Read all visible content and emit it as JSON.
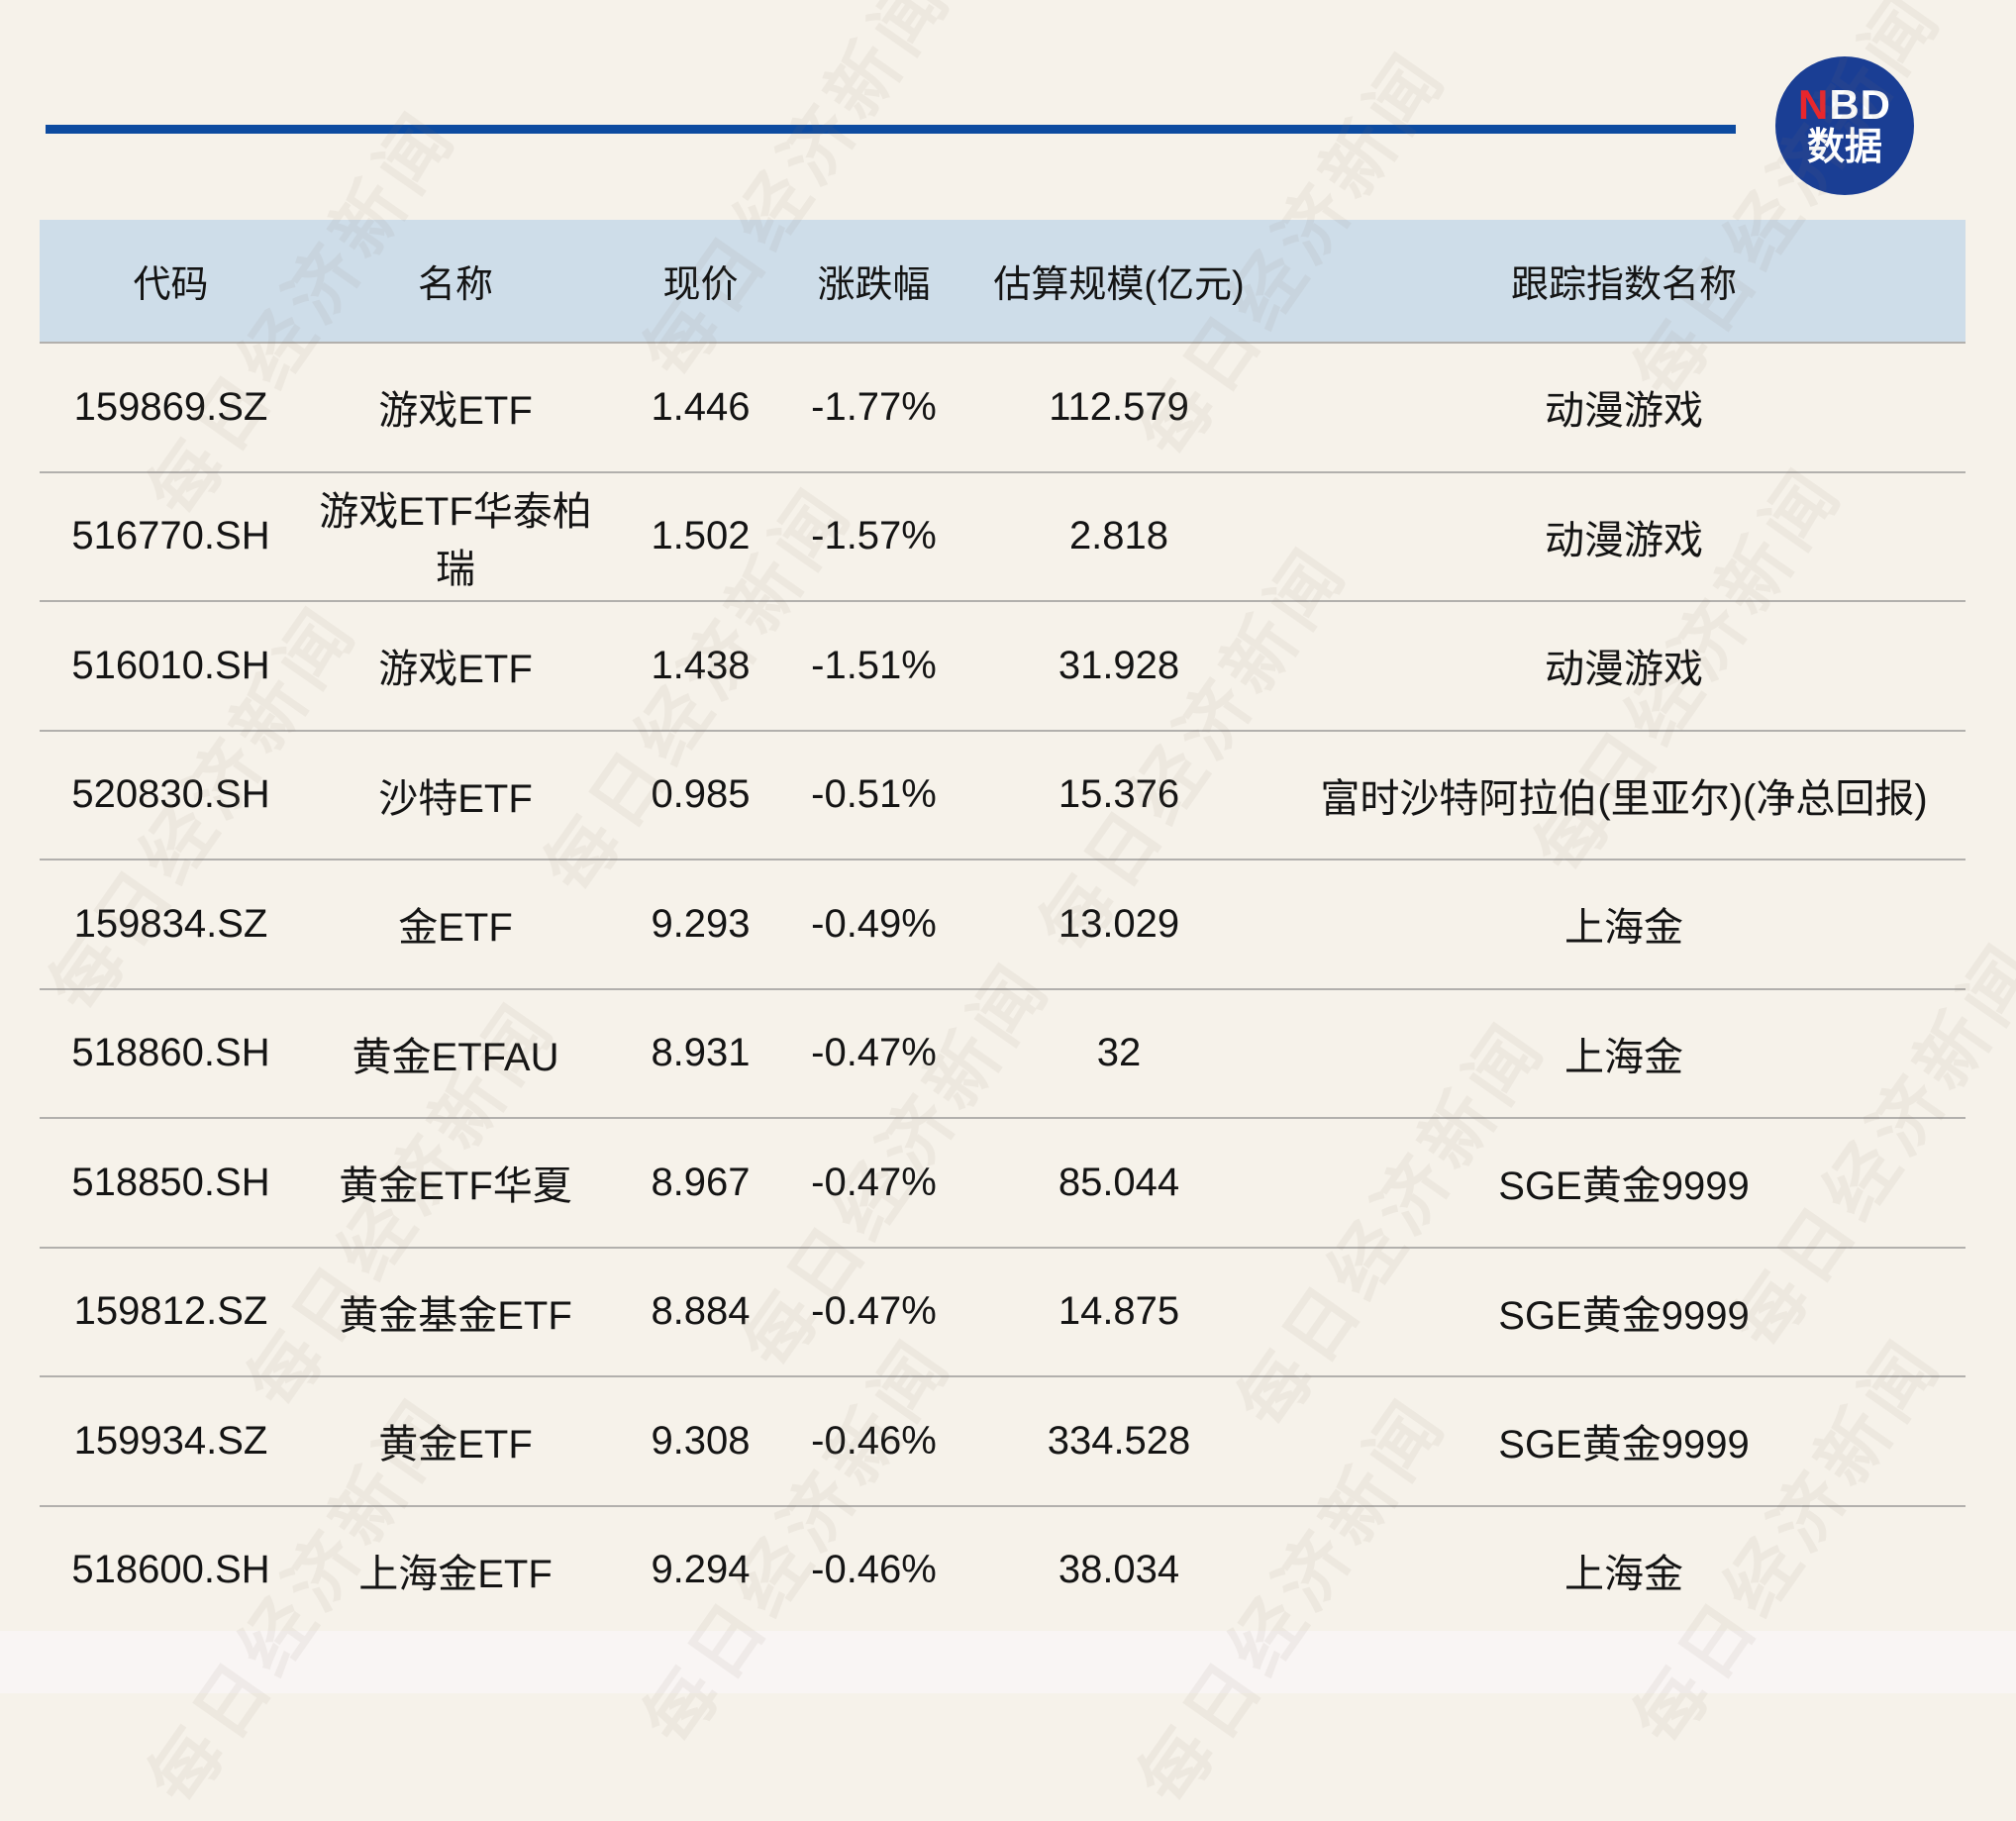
{
  "page": {
    "background_color": "#f6f2ea",
    "footer_band_color": "#f9f5f4"
  },
  "accent_line_color": "#0d4ba0",
  "logo": {
    "text_red": "N",
    "text_white": "BD",
    "subtitle": "数据",
    "circle_color": "#1a3e94",
    "accent_red": "#e8262c"
  },
  "watermark_text": "每日经济新闻",
  "chart_data": {
    "type": "table",
    "title": "",
    "header_bg": "#cedde9",
    "divider_color": "#b2b0ad",
    "columns": [
      "代码",
      "名称",
      "现价",
      "涨跌幅",
      "估算规模(亿元)",
      "跟踪指数名称"
    ],
    "rows": [
      [
        "159869.SZ",
        "游戏ETF",
        "1.446",
        "-1.77%",
        "112.579",
        "动漫游戏"
      ],
      [
        "516770.SH",
        "游戏ETF华泰柏瑞",
        "1.502",
        "-1.57%",
        "2.818",
        "动漫游戏"
      ],
      [
        "516010.SH",
        "游戏ETF",
        "1.438",
        "-1.51%",
        "31.928",
        "动漫游戏"
      ],
      [
        "520830.SH",
        "沙特ETF",
        "0.985",
        "-0.51%",
        "15.376",
        "富时沙特阿拉伯(里亚尔)(净总回报)"
      ],
      [
        "159834.SZ",
        "金ETF",
        "9.293",
        "-0.49%",
        "13.029",
        "上海金"
      ],
      [
        "518860.SH",
        "黄金ETFAU",
        "8.931",
        "-0.47%",
        "32",
        "上海金"
      ],
      [
        "518850.SH",
        "黄金ETF华夏",
        "8.967",
        "-0.47%",
        "85.044",
        "SGE黄金9999"
      ],
      [
        "159812.SZ",
        "黄金基金ETF",
        "8.884",
        "-0.47%",
        "14.875",
        "SGE黄金9999"
      ],
      [
        "159934.SZ",
        "黄金ETF",
        "9.308",
        "-0.46%",
        "334.528",
        "SGE黄金9999"
      ],
      [
        "518600.SH",
        "上海金ETF",
        "9.294",
        "-0.46%",
        "38.034",
        "上海金"
      ]
    ]
  }
}
